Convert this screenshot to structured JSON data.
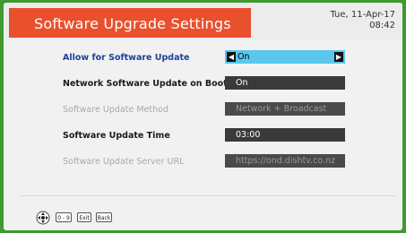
{
  "header": {
    "title": "Software Upgrade Settings",
    "date": "Tue, 11-Apr-17",
    "time": "08:42"
  },
  "settings": [
    {
      "label": "Allow for Software Update",
      "value": "On",
      "state": "selected"
    },
    {
      "label": "Network Software Update on Boot",
      "value": "On",
      "state": "normal"
    },
    {
      "label": "Software Update Method",
      "value": "Network + Broadcast",
      "state": "disabled"
    },
    {
      "label": "Software Update Time",
      "value": "03:00",
      "state": "normal"
    },
    {
      "label": "Software Update Server URL",
      "value": "https://ond.dishtv.co.nz",
      "state": "disabled"
    }
  ],
  "footer": {
    "icons": [
      "nav-pad-icon"
    ],
    "keys": [
      "0 - 9",
      "Exit",
      "Back"
    ]
  },
  "colors": {
    "title_bar": "#e8502e",
    "selected_value": "#5bc7ec",
    "active_label": "#1e3f9c",
    "frame": "#3f9a2f"
  }
}
